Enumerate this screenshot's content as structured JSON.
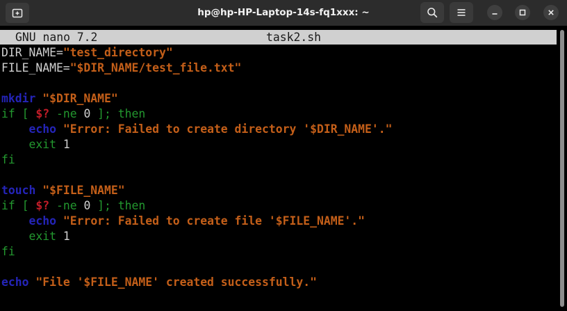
{
  "window": {
    "title": "hp@hp-HP-Laptop-14s-fq1xxx: ~"
  },
  "icons": {
    "new_tab": "new-tab-icon",
    "search": "search-icon",
    "menu": "hamburger-menu-icon",
    "minimize": "minimize-icon",
    "maximize": "maximize-icon",
    "close": "close-icon"
  },
  "colors": {
    "string": "#c45f19",
    "command": "#2424b8",
    "keyword": "#23982f",
    "variable": "#c01c28",
    "plain": "#d0d0d0",
    "header_bg": "#d0d0d0"
  },
  "nano": {
    "version": "GNU nano 7.2",
    "filename": "task2.sh"
  },
  "code_lines": [
    [
      {
        "t": "DIR_NAME=",
        "c": "plain"
      },
      {
        "t": "\"test_directory\"",
        "c": "string"
      }
    ],
    [
      {
        "t": "FILE_NAME=",
        "c": "plain"
      },
      {
        "t": "\"$DIR_NAME/test_file.txt\"",
        "c": "string"
      }
    ],
    [],
    [
      {
        "t": "mkdir",
        "c": "cmd"
      },
      {
        "t": " ",
        "c": "plain"
      },
      {
        "t": "\"$DIR_NAME\"",
        "c": "string"
      }
    ],
    [
      {
        "t": "if [ ",
        "c": "kw"
      },
      {
        "t": "$?",
        "c": "var"
      },
      {
        "t": " -ne ",
        "c": "kw"
      },
      {
        "t": "0",
        "c": "plain"
      },
      {
        "t": " ]; then",
        "c": "kw"
      }
    ],
    [
      {
        "t": "    ",
        "c": "plain"
      },
      {
        "t": "echo",
        "c": "cmd"
      },
      {
        "t": " ",
        "c": "plain"
      },
      {
        "t": "\"Error: Failed to create directory '$DIR_NAME'.\"",
        "c": "string"
      }
    ],
    [
      {
        "t": "    ",
        "c": "plain"
      },
      {
        "t": "exit",
        "c": "kw"
      },
      {
        "t": " 1",
        "c": "plain"
      }
    ],
    [
      {
        "t": "fi",
        "c": "kw"
      }
    ],
    [],
    [
      {
        "t": "touch",
        "c": "cmd"
      },
      {
        "t": " ",
        "c": "plain"
      },
      {
        "t": "\"$FILE_NAME\"",
        "c": "string"
      }
    ],
    [
      {
        "t": "if [ ",
        "c": "kw"
      },
      {
        "t": "$?",
        "c": "var"
      },
      {
        "t": " -ne ",
        "c": "kw"
      },
      {
        "t": "0",
        "c": "plain"
      },
      {
        "t": " ]; then",
        "c": "kw"
      }
    ],
    [
      {
        "t": "    ",
        "c": "plain"
      },
      {
        "t": "echo",
        "c": "cmd"
      },
      {
        "t": " ",
        "c": "plain"
      },
      {
        "t": "\"Error: Failed to create file '$FILE_NAME'.\"",
        "c": "string"
      }
    ],
    [
      {
        "t": "    ",
        "c": "plain"
      },
      {
        "t": "exit",
        "c": "kw"
      },
      {
        "t": " 1",
        "c": "plain"
      }
    ],
    [
      {
        "t": "fi",
        "c": "kw"
      }
    ],
    [],
    [
      {
        "t": "echo",
        "c": "cmd"
      },
      {
        "t": " ",
        "c": "plain"
      },
      {
        "t": "\"File '$FILE_NAME' created successfully.\"",
        "c": "string"
      }
    ]
  ]
}
